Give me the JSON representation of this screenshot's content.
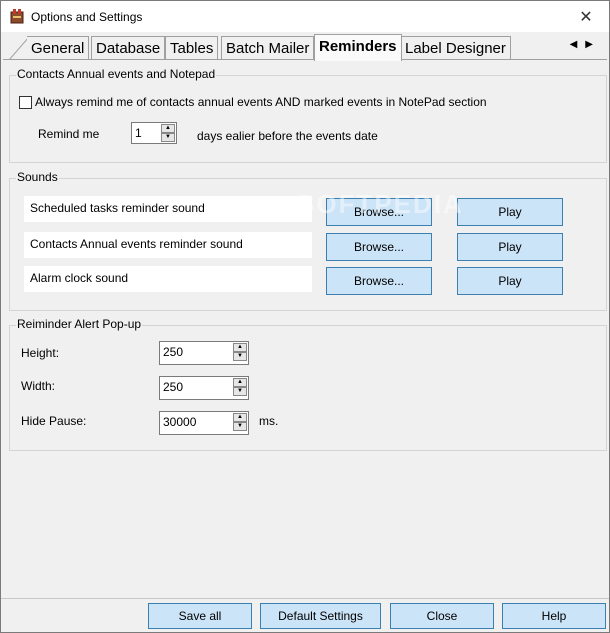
{
  "window": {
    "title": "Options and Settings"
  },
  "tabs": [
    {
      "label": "General"
    },
    {
      "label": "Database"
    },
    {
      "label": "Tables"
    },
    {
      "label": "Batch Mailer"
    },
    {
      "label": "Reminders"
    },
    {
      "label": "Label Designer"
    }
  ],
  "contacts_group": {
    "title": "Contacts Annual events and Notepad",
    "always_remind_label": "Always remind me of contacts annual events AND marked events in NotePad section",
    "always_remind_checked": false,
    "remind_me_label": "Remind me",
    "remind_days_value": "1",
    "days_suffix": "days ealier before the events date"
  },
  "sounds_group": {
    "title": "Sounds",
    "rows": [
      {
        "label": "Scheduled tasks reminder sound",
        "browse": "Browse...",
        "play": "Play"
      },
      {
        "label": "Contacts Annual events reminder sound",
        "browse": "Browse...",
        "play": "Play"
      },
      {
        "label": "Alarm clock sound",
        "browse": "Browse...",
        "play": "Play"
      }
    ]
  },
  "popup_group": {
    "title": "Reiminder Alert Pop-up",
    "height_label": "Height:",
    "height_value": "250",
    "width_label": "Width:",
    "width_value": "250",
    "hide_pause_label": "Hide Pause:",
    "hide_pause_value": "30000",
    "hide_pause_unit": "ms."
  },
  "footer": {
    "save_all": "Save all",
    "default_settings": "Default Settings",
    "close": "Close",
    "help": "Help"
  },
  "watermark": "SOFTPEDIA",
  "colors": {
    "button_fill": "#cce4f7",
    "button_border": "#3c7fb1",
    "background": "#f0f0f0"
  }
}
